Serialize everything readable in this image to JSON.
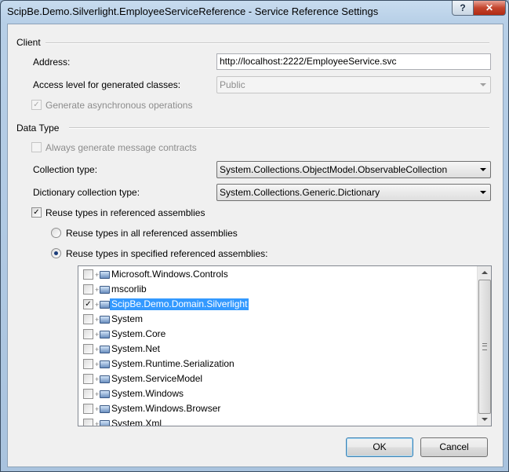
{
  "window": {
    "title": "ScipBe.Demo.Silverlight.EmployeeServiceReference - Service Reference Settings",
    "help_label": "?",
    "close_label": "✕"
  },
  "client_group": {
    "title": "Client",
    "address_label": "Address:",
    "address_value": "http://localhost:2222/EmployeeService.svc",
    "access_level_label": "Access level for generated classes:",
    "access_level_value": "Public",
    "generate_async_label": "Generate asynchronous operations",
    "generate_async_checked": true
  },
  "data_type_group": {
    "title": "Data Type",
    "always_generate_label": "Always generate message contracts",
    "always_generate_checked": false,
    "collection_type_label": "Collection type:",
    "collection_type_value": "System.Collections.ObjectModel.ObservableCollection",
    "dictionary_type_label": "Dictionary collection type:",
    "dictionary_type_value": "System.Collections.Generic.Dictionary",
    "reuse_types_label": "Reuse types in referenced assemblies",
    "reuse_types_checked": true,
    "reuse_all_label": "Reuse types in all referenced assemblies",
    "reuse_specified_label": "Reuse types in specified referenced assemblies:",
    "selected_option": "specified"
  },
  "assemblies": [
    {
      "name": "Microsoft.Windows.Controls",
      "checked": false,
      "selected": false
    },
    {
      "name": "mscorlib",
      "checked": false,
      "selected": false
    },
    {
      "name": "ScipBe.Demo.Domain.Silverlight",
      "checked": true,
      "selected": true
    },
    {
      "name": "System",
      "checked": false,
      "selected": false
    },
    {
      "name": "System.Core",
      "checked": false,
      "selected": false
    },
    {
      "name": "System.Net",
      "checked": false,
      "selected": false
    },
    {
      "name": "System.Runtime.Serialization",
      "checked": false,
      "selected": false
    },
    {
      "name": "System.ServiceModel",
      "checked": false,
      "selected": false
    },
    {
      "name": "System.Windows",
      "checked": false,
      "selected": false
    },
    {
      "name": "System.Windows.Browser",
      "checked": false,
      "selected": false
    },
    {
      "name": "System.Xml",
      "checked": false,
      "selected": false
    }
  ],
  "buttons": {
    "ok_label": "OK",
    "cancel_label": "Cancel"
  },
  "colors": {
    "selection": "#3399ff",
    "close_button": "#c4452d"
  }
}
